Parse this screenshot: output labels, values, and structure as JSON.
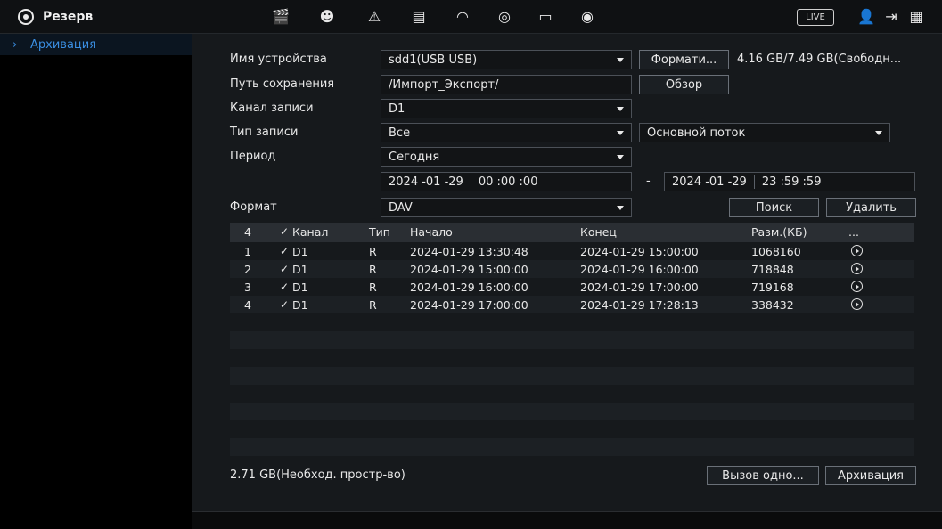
{
  "header": {
    "title": "Резерв",
    "live_label": "LIVE",
    "icons": [
      "film-icon",
      "face-icon",
      "alarm-light-icon",
      "storage-icon",
      "speedometer-icon",
      "backup-icon",
      "monitor-icon",
      "speaker-icon",
      "user-icon",
      "logout-icon",
      "qr-code-icon"
    ]
  },
  "sidebar": {
    "items": [
      {
        "label": "Архивация",
        "chevron": "›"
      }
    ]
  },
  "form": {
    "device_name_label": "Имя устройства",
    "device_name_value": "sdd1(USB USB)",
    "format_button": "Формати...",
    "storage_info": "4.16 GB/7.49 GB(Свободн...",
    "save_path_label": "Путь сохранения",
    "save_path_value": "/Импорт_Экспорт/",
    "browse_button": "Обзор",
    "channel_label": "Канал записи",
    "channel_value": "D1",
    "record_type_label": "Тип записи",
    "record_type_value": "Все",
    "stream_value": "Основной поток",
    "period_label": "Период",
    "period_value": "Сегодня",
    "start_date": "2024 -01 -29",
    "start_time": "00 :00 :00",
    "range_dash": "-",
    "end_date": "2024 -01 -29",
    "end_time": "23 :59 :59",
    "format_label": "Формат",
    "format_value": "DAV",
    "search_button": "Поиск",
    "delete_button": "Удалить"
  },
  "table": {
    "headers": {
      "index": "4",
      "channel": "Канал",
      "type": "Тип",
      "start": "Начало",
      "end": "Конец",
      "size": "Разм.(КБ)",
      "more": "..."
    },
    "rows": [
      {
        "index": "1",
        "channel": "D1",
        "type": "R",
        "start": "2024-01-29 13:30:48",
        "end": "2024-01-29 15:00:00",
        "size": "1068160"
      },
      {
        "index": "2",
        "channel": "D1",
        "type": "R",
        "start": "2024-01-29 15:00:00",
        "end": "2024-01-29 16:00:00",
        "size": "718848"
      },
      {
        "index": "3",
        "channel": "D1",
        "type": "R",
        "start": "2024-01-29 16:00:00",
        "end": "2024-01-29 17:00:00",
        "size": "719168"
      },
      {
        "index": "4",
        "channel": "D1",
        "type": "R",
        "start": "2024-01-29 17:00:00",
        "end": "2024-01-29 17:28:13",
        "size": "338432"
      }
    ]
  },
  "footer": {
    "required_space": "2.71 GB(Необход. простр-во)",
    "one_click_button": "Вызов одно...",
    "archive_button": "Архивация"
  },
  "colors": {
    "accent": "#3a8de0",
    "background": "#16191c",
    "row_alt": "#1c2024"
  }
}
